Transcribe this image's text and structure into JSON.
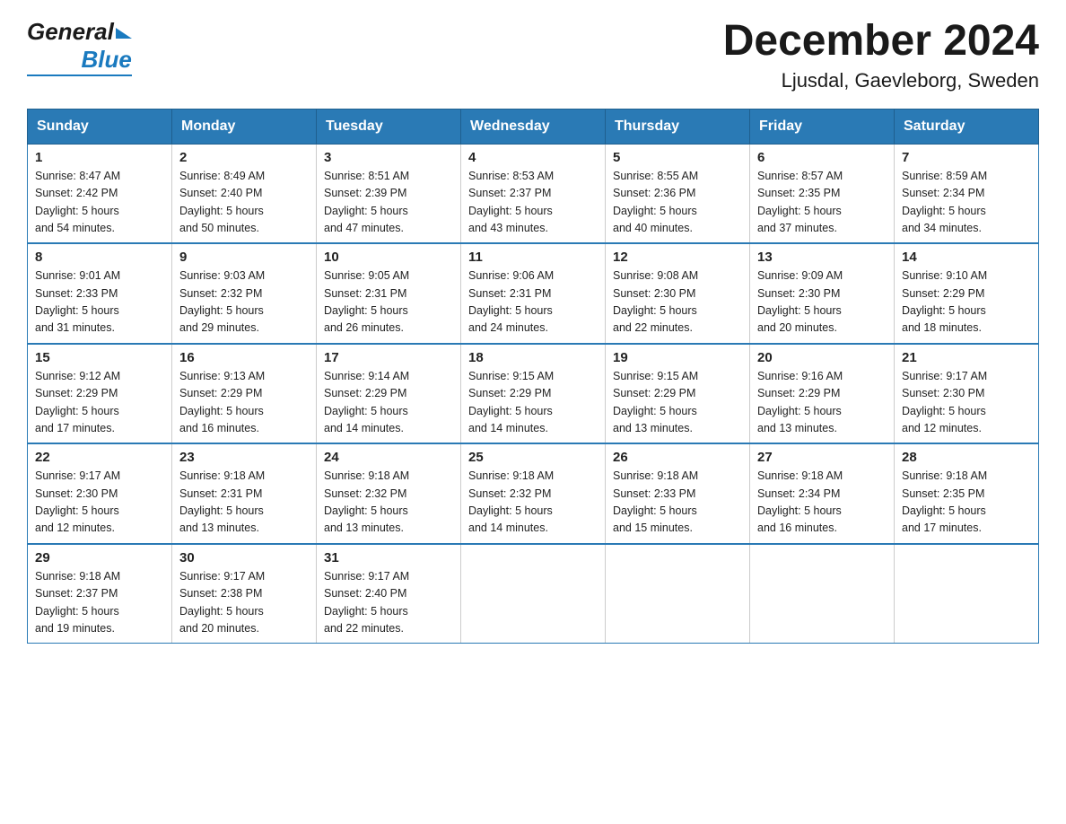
{
  "header": {
    "title": "December 2024",
    "subtitle": "Ljusdal, Gaevleborg, Sweden",
    "logo_general": "General",
    "logo_blue": "Blue"
  },
  "days_of_week": [
    "Sunday",
    "Monday",
    "Tuesday",
    "Wednesday",
    "Thursday",
    "Friday",
    "Saturday"
  ],
  "weeks": [
    [
      {
        "day": "1",
        "sunrise": "8:47 AM",
        "sunset": "2:42 PM",
        "daylight": "5 hours and 54 minutes."
      },
      {
        "day": "2",
        "sunrise": "8:49 AM",
        "sunset": "2:40 PM",
        "daylight": "5 hours and 50 minutes."
      },
      {
        "day": "3",
        "sunrise": "8:51 AM",
        "sunset": "2:39 PM",
        "daylight": "5 hours and 47 minutes."
      },
      {
        "day": "4",
        "sunrise": "8:53 AM",
        "sunset": "2:37 PM",
        "daylight": "5 hours and 43 minutes."
      },
      {
        "day": "5",
        "sunrise": "8:55 AM",
        "sunset": "2:36 PM",
        "daylight": "5 hours and 40 minutes."
      },
      {
        "day": "6",
        "sunrise": "8:57 AM",
        "sunset": "2:35 PM",
        "daylight": "5 hours and 37 minutes."
      },
      {
        "day": "7",
        "sunrise": "8:59 AM",
        "sunset": "2:34 PM",
        "daylight": "5 hours and 34 minutes."
      }
    ],
    [
      {
        "day": "8",
        "sunrise": "9:01 AM",
        "sunset": "2:33 PM",
        "daylight": "5 hours and 31 minutes."
      },
      {
        "day": "9",
        "sunrise": "9:03 AM",
        "sunset": "2:32 PM",
        "daylight": "5 hours and 29 minutes."
      },
      {
        "day": "10",
        "sunrise": "9:05 AM",
        "sunset": "2:31 PM",
        "daylight": "5 hours and 26 minutes."
      },
      {
        "day": "11",
        "sunrise": "9:06 AM",
        "sunset": "2:31 PM",
        "daylight": "5 hours and 24 minutes."
      },
      {
        "day": "12",
        "sunrise": "9:08 AM",
        "sunset": "2:30 PM",
        "daylight": "5 hours and 22 minutes."
      },
      {
        "day": "13",
        "sunrise": "9:09 AM",
        "sunset": "2:30 PM",
        "daylight": "5 hours and 20 minutes."
      },
      {
        "day": "14",
        "sunrise": "9:10 AM",
        "sunset": "2:29 PM",
        "daylight": "5 hours and 18 minutes."
      }
    ],
    [
      {
        "day": "15",
        "sunrise": "9:12 AM",
        "sunset": "2:29 PM",
        "daylight": "5 hours and 17 minutes."
      },
      {
        "day": "16",
        "sunrise": "9:13 AM",
        "sunset": "2:29 PM",
        "daylight": "5 hours and 16 minutes."
      },
      {
        "day": "17",
        "sunrise": "9:14 AM",
        "sunset": "2:29 PM",
        "daylight": "5 hours and 14 minutes."
      },
      {
        "day": "18",
        "sunrise": "9:15 AM",
        "sunset": "2:29 PM",
        "daylight": "5 hours and 14 minutes."
      },
      {
        "day": "19",
        "sunrise": "9:15 AM",
        "sunset": "2:29 PM",
        "daylight": "5 hours and 13 minutes."
      },
      {
        "day": "20",
        "sunrise": "9:16 AM",
        "sunset": "2:29 PM",
        "daylight": "5 hours and 13 minutes."
      },
      {
        "day": "21",
        "sunrise": "9:17 AM",
        "sunset": "2:30 PM",
        "daylight": "5 hours and 12 minutes."
      }
    ],
    [
      {
        "day": "22",
        "sunrise": "9:17 AM",
        "sunset": "2:30 PM",
        "daylight": "5 hours and 12 minutes."
      },
      {
        "day": "23",
        "sunrise": "9:18 AM",
        "sunset": "2:31 PM",
        "daylight": "5 hours and 13 minutes."
      },
      {
        "day": "24",
        "sunrise": "9:18 AM",
        "sunset": "2:32 PM",
        "daylight": "5 hours and 13 minutes."
      },
      {
        "day": "25",
        "sunrise": "9:18 AM",
        "sunset": "2:32 PM",
        "daylight": "5 hours and 14 minutes."
      },
      {
        "day": "26",
        "sunrise": "9:18 AM",
        "sunset": "2:33 PM",
        "daylight": "5 hours and 15 minutes."
      },
      {
        "day": "27",
        "sunrise": "9:18 AM",
        "sunset": "2:34 PM",
        "daylight": "5 hours and 16 minutes."
      },
      {
        "day": "28",
        "sunrise": "9:18 AM",
        "sunset": "2:35 PM",
        "daylight": "5 hours and 17 minutes."
      }
    ],
    [
      {
        "day": "29",
        "sunrise": "9:18 AM",
        "sunset": "2:37 PM",
        "daylight": "5 hours and 19 minutes."
      },
      {
        "day": "30",
        "sunrise": "9:17 AM",
        "sunset": "2:38 PM",
        "daylight": "5 hours and 20 minutes."
      },
      {
        "day": "31",
        "sunrise": "9:17 AM",
        "sunset": "2:40 PM",
        "daylight": "5 hours and 22 minutes."
      },
      null,
      null,
      null,
      null
    ]
  ]
}
